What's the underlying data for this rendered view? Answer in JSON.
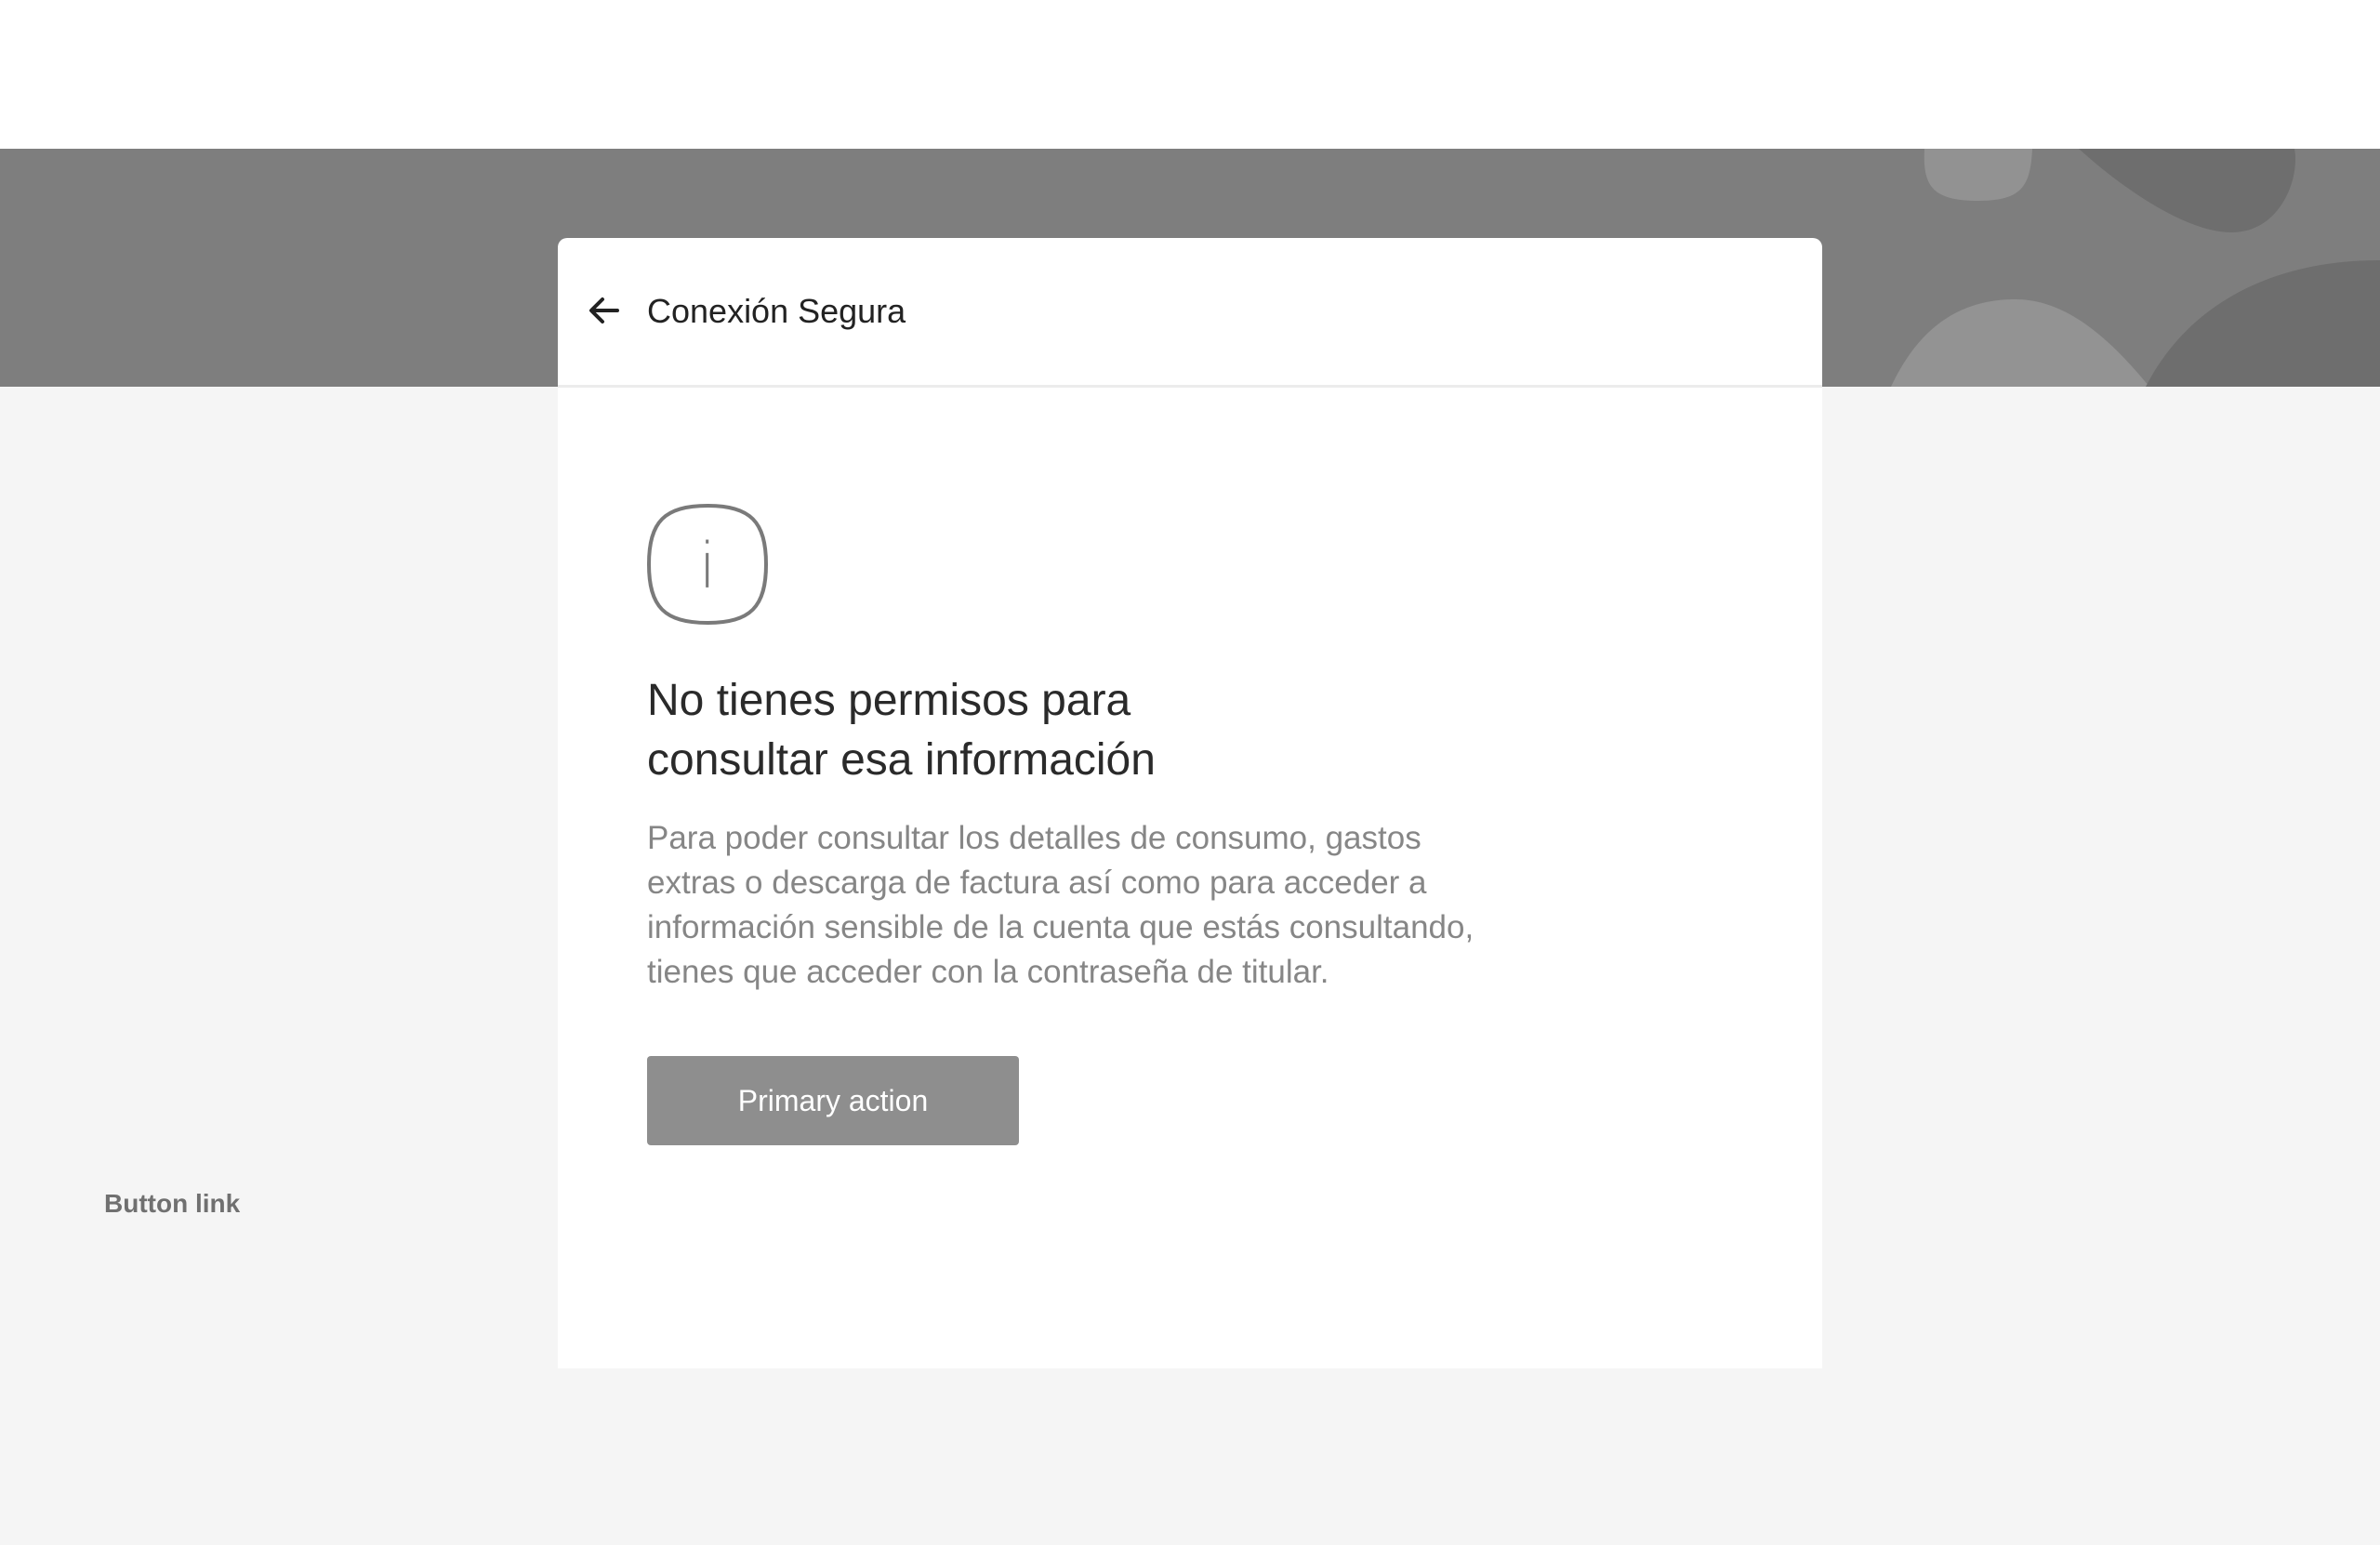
{
  "header": {
    "back_icon": "arrow-left-icon",
    "title": "Conexión Segura"
  },
  "content": {
    "icon": "info-icon",
    "icon_glyph": "i",
    "headline_lines": [
      "No tienes permisos para",
      "consultar esa información"
    ],
    "description_lines": [
      "Para poder consultar los detalles de consumo, gastos",
      "extras o descarga de factura así como para acceder a",
      "información sensible de la cuenta que estás consultando,",
      "tienes que acceder con la contraseña de titular."
    ]
  },
  "actions": {
    "primary_label": "Primary action",
    "link_label": "Button link"
  },
  "colors": {
    "hero_background": "#7e7e7e",
    "page_background": "#f5f5f5",
    "primary_button": "#8e8e8e"
  }
}
